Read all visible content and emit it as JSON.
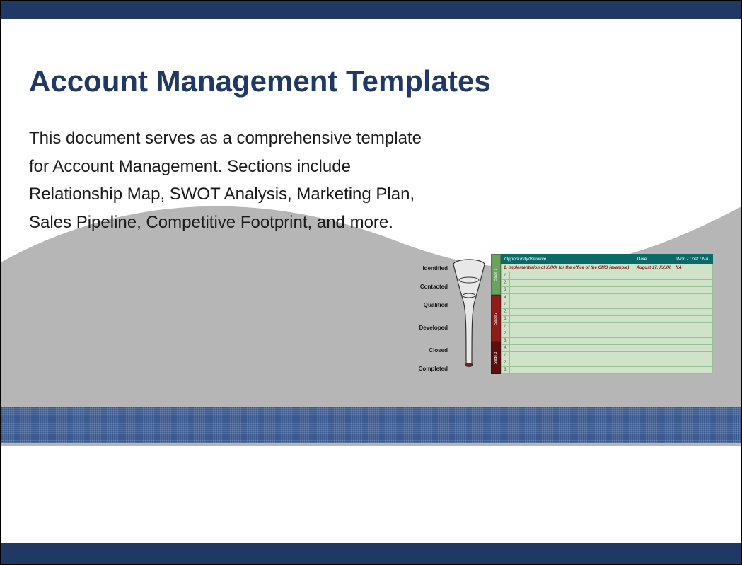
{
  "slide": {
    "title": "Account Management Templates",
    "body": "This document serves as a comprehensive template for Account Management.  Sections include Relationship Map, SWOT Analysis, Marketing Plan, Sales Pipeline, Competitive Footprint, and more."
  },
  "funnel": {
    "stages": [
      "Identified",
      "Contacted",
      "Qualified",
      "Developed",
      "Closed",
      "Completed"
    ]
  },
  "opportunity_table": {
    "headers": [
      "Opportunity/Initiative",
      "Date",
      "Won / Lost / NA"
    ],
    "example_row": {
      "label": "1. Implementation of XXXX for the office of the CMO (example)",
      "date": "August 17, XXXX",
      "status": "NA"
    },
    "vtabs": [
      {
        "label": "Stage 1",
        "color": "#6aa35f",
        "rows": 5
      },
      {
        "label": "Stage 2",
        "color": "#8f1b1b",
        "rows": 6
      },
      {
        "label": "Stage 3",
        "color": "#5c0f0f",
        "rows": 4
      }
    ]
  },
  "colors": {
    "primary": "#1f3864",
    "accent_mid": "#3b5a8f",
    "table_header": "#0a6a6a",
    "table_cell": "#cfe3c9",
    "wave": "#b6b6b6"
  }
}
